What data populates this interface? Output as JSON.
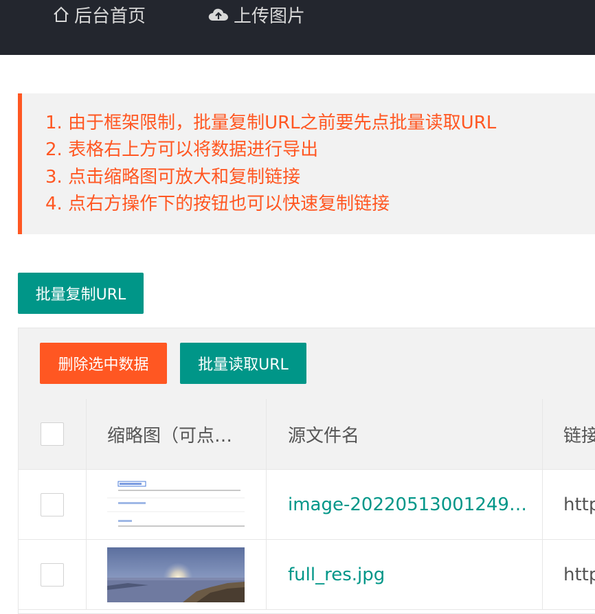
{
  "nav": {
    "home_label": "后台首页",
    "upload_label": "上传图片"
  },
  "notice": {
    "lines": [
      "1. 由于框架限制，批量复制URL之前要先点批量读取URL",
      "2. 表格右上方可以将数据进行导出",
      "3. 点击缩略图可放大和复制链接",
      "4. 点右方操作下的按钮也可以快速复制链接"
    ]
  },
  "buttons": {
    "batch_copy_url": "批量复制URL",
    "delete_selected": "删除选中数据",
    "batch_read_url": "批量读取URL"
  },
  "table": {
    "columns": [
      "缩略图（可点…",
      "源文件名",
      "链接"
    ],
    "rows": [
      {
        "file_name": "image-20220513001249…",
        "link": "http"
      },
      {
        "file_name": "full_res.jpg",
        "link": "http"
      }
    ]
  },
  "colors": {
    "topbar": "#23262e",
    "accent_teal": "#009688",
    "accent_orange": "#ff5722"
  }
}
